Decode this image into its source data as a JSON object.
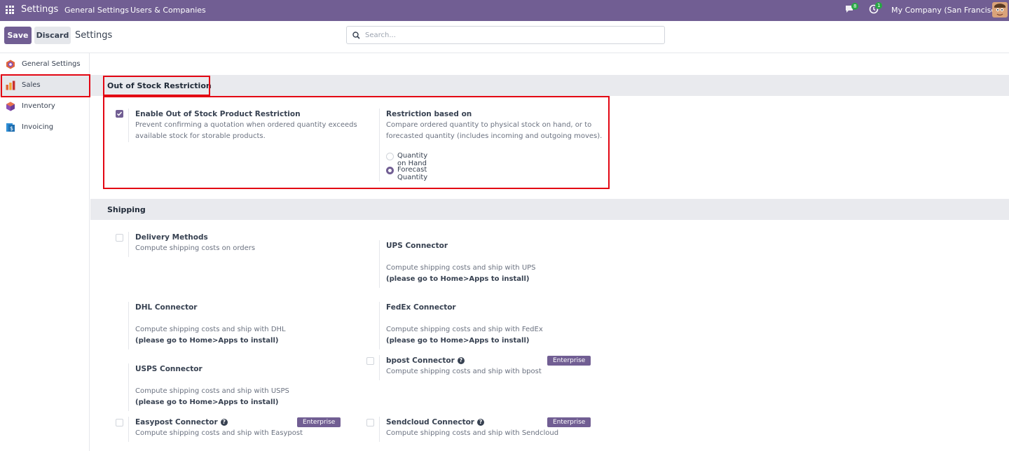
{
  "topnav": {
    "brand": "Settings",
    "menus": [
      "General Settings",
      "Users & Companies"
    ],
    "messages_count": "8",
    "activities_count": "1",
    "company": "My Company (San Francisco)"
  },
  "control_panel": {
    "save_label": "Save",
    "discard_label": "Discard",
    "title": "Settings",
    "search_placeholder": "Search..."
  },
  "sidebar": {
    "items": [
      {
        "label": "General Settings",
        "icon": "odoo-settings-icon"
      },
      {
        "label": "Sales",
        "icon": "sales-chart-icon",
        "active": true
      },
      {
        "label": "Inventory",
        "icon": "inventory-box-icon"
      },
      {
        "label": "Invoicing",
        "icon": "invoicing-icon"
      }
    ]
  },
  "sections": {
    "out_of_stock": {
      "title": "Out of Stock Restriction",
      "enable": {
        "name": "Enable Out of Stock Product Restriction",
        "desc1": "Prevent confirming a quotation when ordered quantity exceeds",
        "desc2": "available stock for storable products.",
        "checked": true
      },
      "restriction": {
        "name": "Restriction based on",
        "desc1": "Compare ordered quantity to physical stock on hand, or to",
        "desc2": "forecasted quantity (includes incoming and outgoing moves).",
        "options": [
          "Quantity on Hand",
          "Forecast Quantity"
        ],
        "selected": "Forecast Quantity"
      }
    },
    "shipping": {
      "title": "Shipping",
      "delivery": {
        "name": "Delivery Methods",
        "desc": "Compute shipping costs on orders",
        "checked": false
      },
      "ups": {
        "name": "UPS Connector",
        "desc": "Compute shipping costs and ship with UPS",
        "note": "(please go to Home>Apps to install)"
      },
      "dhl": {
        "name": "DHL Connector",
        "desc": "Compute shipping costs and ship with DHL",
        "note": "(please go to Home>Apps to install)"
      },
      "fedex": {
        "name": "FedEx Connector",
        "desc": "Compute shipping costs and ship with FedEx",
        "note": "(please go to Home>Apps to install)"
      },
      "usps": {
        "name": "USPS Connector",
        "desc": "Compute shipping costs and ship with USPS",
        "note": "(please go to Home>Apps to install)"
      },
      "bpost": {
        "name": "bpost Connector",
        "desc": "Compute shipping costs and ship with bpost",
        "badge": "Enterprise",
        "checked": false
      },
      "easypost": {
        "name": "Easypost Connector",
        "desc": "Compute shipping costs and ship with Easypost",
        "badge": "Enterprise",
        "checked": false
      },
      "sendcloud": {
        "name": "Sendcloud Connector",
        "desc": "Compute shipping costs and ship with Sendcloud",
        "badge": "Enterprise",
        "checked": false
      }
    }
  },
  "colors": {
    "brand": "#715e93",
    "highlight": "#e30613",
    "section_bg": "#e9eaee"
  }
}
